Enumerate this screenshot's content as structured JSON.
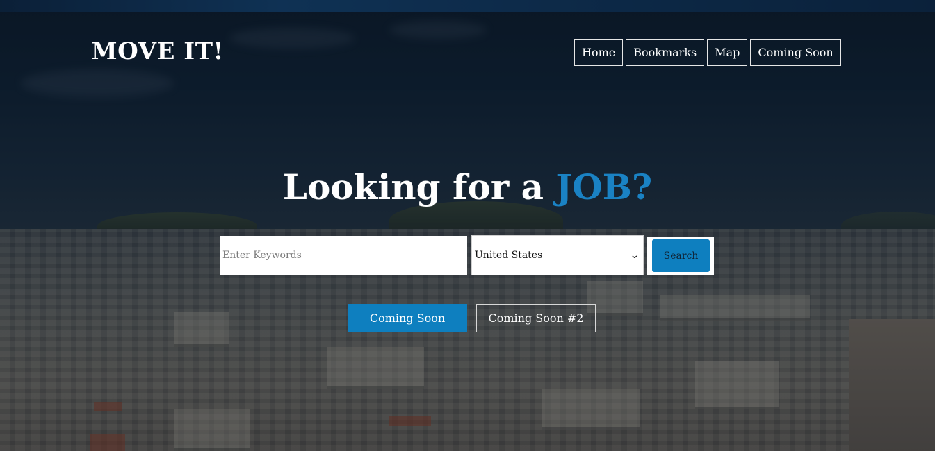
{
  "brand": {
    "logo_text": "MOVE IT!"
  },
  "nav": {
    "items": [
      {
        "label": "Home"
      },
      {
        "label": "Bookmarks"
      },
      {
        "label": "Map"
      },
      {
        "label": "Coming Soon"
      }
    ]
  },
  "hero": {
    "headline_prefix": "Looking for a ",
    "headline_accent": "JOB?",
    "accent_color": "#1a82c4"
  },
  "search": {
    "keywords_value": "",
    "keywords_placeholder": "Enter Keywords",
    "country_selected": "United States",
    "submit_label": "Search"
  },
  "cta": {
    "primary_label": "Coming Soon",
    "secondary_label": "Coming Soon #2"
  },
  "colors": {
    "brand_blue": "#0e7fbf"
  }
}
